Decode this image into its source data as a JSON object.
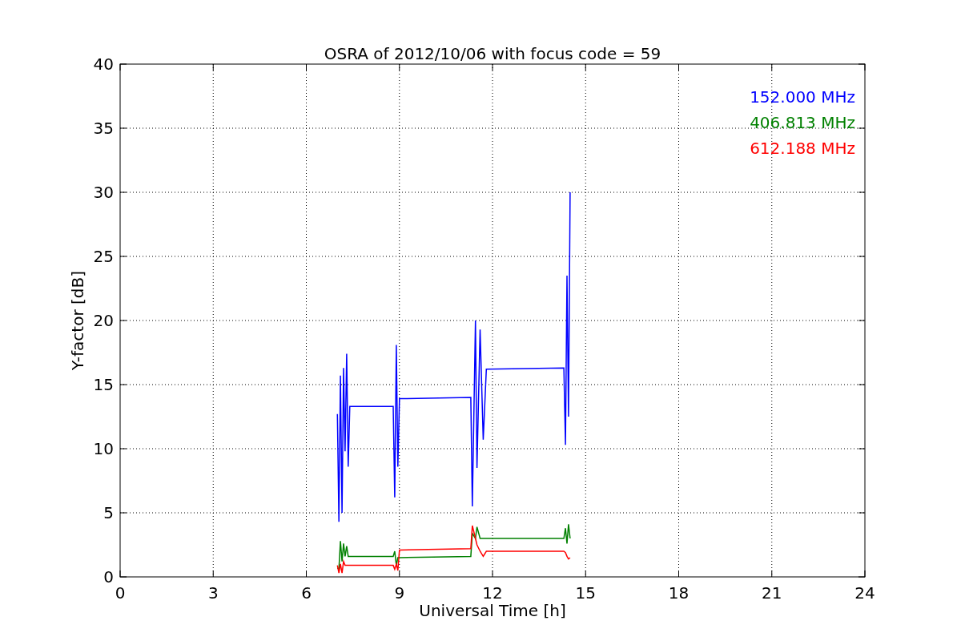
{
  "chart_data": {
    "type": "line",
    "title": "OSRA of 2012/10/06 with focus code = 59",
    "xlabel": "Universal Time [h]",
    "ylabel": "Y-factor [dB]",
    "x": [
      7.0,
      7.05,
      7.1,
      7.15,
      7.2,
      7.25,
      7.3,
      7.35,
      7.4,
      8.8,
      8.85,
      8.9,
      8.95,
      9.0,
      11.3,
      11.35,
      11.45,
      11.5,
      11.6,
      11.7,
      11.8,
      14.3,
      14.35,
      14.4,
      14.45,
      14.5
    ],
    "series": [
      {
        "name": "152.000 MHz",
        "color": "#0000ff",
        "values": [
          12.7,
          4.3,
          15.7,
          5,
          16.3,
          9.8,
          17.4,
          8.6,
          13.3,
          13.3,
          6.2,
          18.1,
          8.6,
          13.9,
          14.0,
          5.5,
          20,
          8.5,
          19.3,
          10.7,
          16.2,
          16.3,
          10.3,
          23.5,
          12.5,
          30
        ]
      },
      {
        "name": "406.813 MHz",
        "color": "#008000",
        "values": [
          0.7,
          0.6,
          2.8,
          1.2,
          2.6,
          1.6,
          2.4,
          1.6,
          1.6,
          1.6,
          2.0,
          0.9,
          1.5,
          1.5,
          1.6,
          3.4,
          3.0,
          3.9,
          3.0,
          3.0,
          3.0,
          3.0,
          3.8,
          2.6,
          4.1,
          3.0
        ]
      },
      {
        "name": "612.188 MHz",
        "color": "#ff0000",
        "values": [
          0.9,
          0.3,
          1.0,
          0.3,
          1.2,
          0.9,
          0.9,
          0.9,
          0.9,
          0.9,
          0.6,
          1.0,
          0.5,
          2.1,
          2.2,
          4.0,
          3.0,
          2.5,
          2.0,
          1.6,
          2.0,
          2.0,
          1.9,
          1.6,
          1.4,
          1.5
        ]
      }
    ],
    "xlim": [
      0,
      24
    ],
    "ylim": [
      0,
      40
    ],
    "xticks": [
      0,
      3,
      6,
      9,
      12,
      15,
      18,
      21,
      24
    ],
    "yticks": [
      0,
      5,
      10,
      15,
      20,
      25,
      30,
      35,
      40
    ],
    "grid": true
  }
}
